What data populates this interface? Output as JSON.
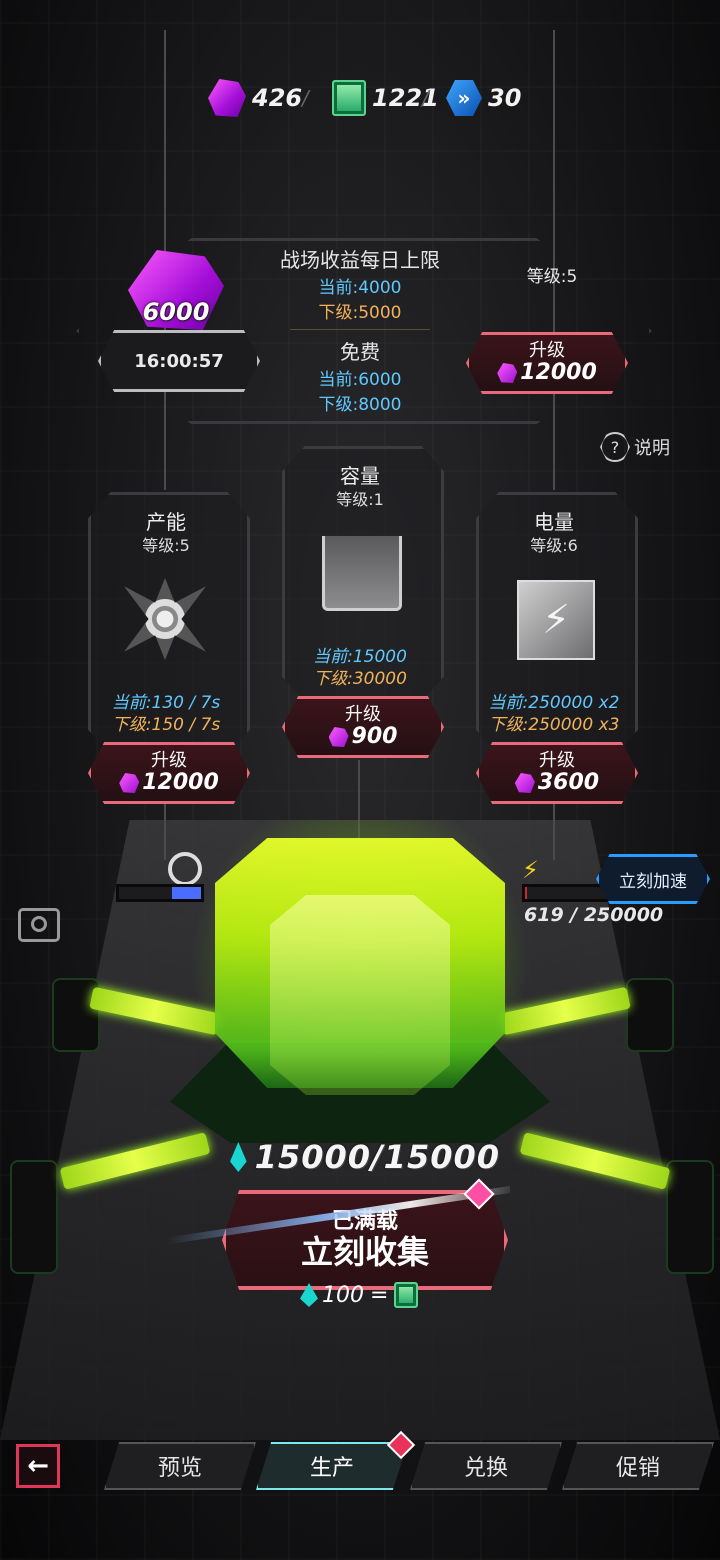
{
  "currencies": [
    {
      "icon": "purple-gem-icon",
      "value": "426"
    },
    {
      "icon": "green-scroll-icon",
      "value": "1221"
    },
    {
      "icon": "blue-chevron-hex-icon",
      "value": "30"
    }
  ],
  "separator": "/",
  "battlefield": {
    "gem_amount": "6000",
    "timer": "16:00:57",
    "title": "战场收益每日上限",
    "current": "当前:4000",
    "next": "下级:5000",
    "free_title": "免费",
    "free_current": "当前:6000",
    "free_next": "下级:8000",
    "level": "等级:5",
    "upgrade_label": "升级",
    "upgrade_cost": "12000"
  },
  "help": {
    "icon_text": "?",
    "label": "说明"
  },
  "production": {
    "title": "产能",
    "level": "等级:5",
    "current": "当前:130 / 7s",
    "next": "下级:150 / 7s",
    "upgrade_label": "升级",
    "upgrade_cost": "12000"
  },
  "capacity": {
    "title": "容量",
    "level": "等级:1",
    "current": "当前:15000",
    "next": "下级:30000",
    "upgrade_label": "升级",
    "upgrade_cost": "900"
  },
  "power": {
    "title": "电量",
    "level": "等级:6",
    "current": "当前:250000 x2",
    "next": "下级:250000 x3",
    "upgrade_label": "升级",
    "upgrade_cost": "3600",
    "progress_text": "619 / 250000",
    "progress_fraction": 0.0025,
    "accelerate_label": "立刻加速"
  },
  "production_bar_fraction": 0.35,
  "storage": {
    "value": "15000/15000"
  },
  "collect": {
    "full_label": "已满载",
    "button_label": "立刻收集"
  },
  "exchange_rate": {
    "amount": "100",
    "equals": "="
  },
  "nav": {
    "back_icon": "←",
    "tabs": [
      {
        "label": "预览",
        "active": false
      },
      {
        "label": "生产",
        "active": true
      },
      {
        "label": "兑换",
        "active": false
      },
      {
        "label": "促销",
        "active": false
      }
    ]
  },
  "colors": {
    "accent_red": "#e96a7a",
    "cyan": "#5fc9ff",
    "orange": "#f2b25a",
    "crystal": "#d8ff20"
  }
}
